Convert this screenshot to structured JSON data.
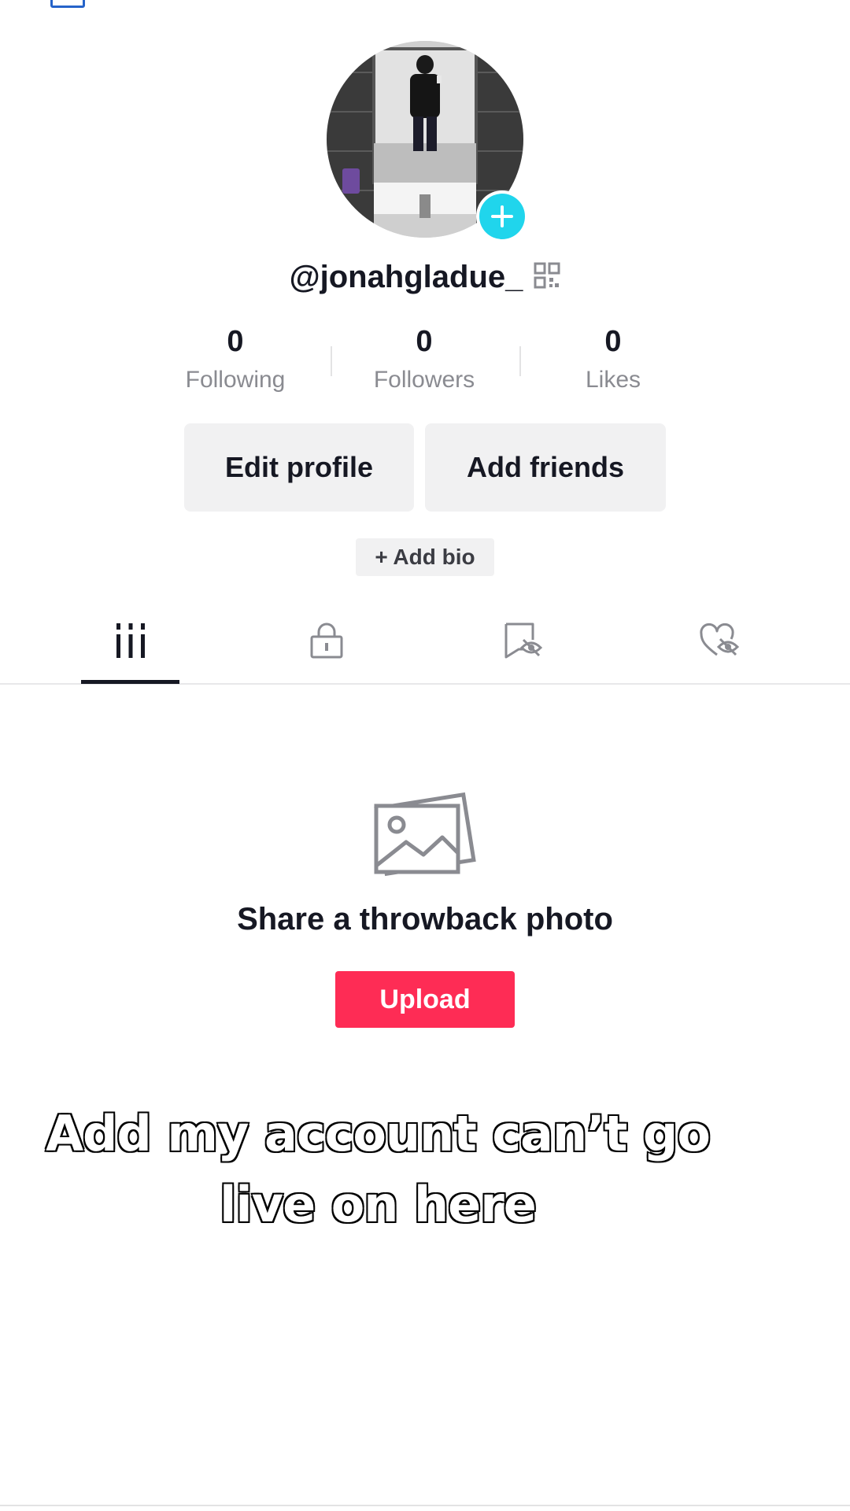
{
  "profile": {
    "username": "@jonahgladue_",
    "avatar_icon": "profile-photo",
    "add_avatar_icon": "plus-icon",
    "qr_icon": "qr-code-icon"
  },
  "stats": [
    {
      "value": "0",
      "label": "Following"
    },
    {
      "value": "0",
      "label": "Followers"
    },
    {
      "value": "0",
      "label": "Likes"
    }
  ],
  "actions": {
    "edit_profile": "Edit profile",
    "add_friends": "Add friends",
    "add_bio": "+ Add bio"
  },
  "tabs": [
    {
      "icon": "grid-videos-icon",
      "active": true
    },
    {
      "icon": "lock-icon",
      "active": false
    },
    {
      "icon": "hidden-saved-icon",
      "active": false
    },
    {
      "icon": "hidden-liked-icon",
      "active": false
    }
  ],
  "empty_state": {
    "icon": "photo-icon",
    "title": "Share a throwback photo",
    "button": "Upload"
  },
  "caption": {
    "line1": "Add my account can’t go",
    "line2": "live on here"
  },
  "colors": {
    "accent": "#fe2c55",
    "add_badge": "#20d5ec",
    "button_bg": "#f1f1f2",
    "muted_text": "#8a8b91"
  }
}
